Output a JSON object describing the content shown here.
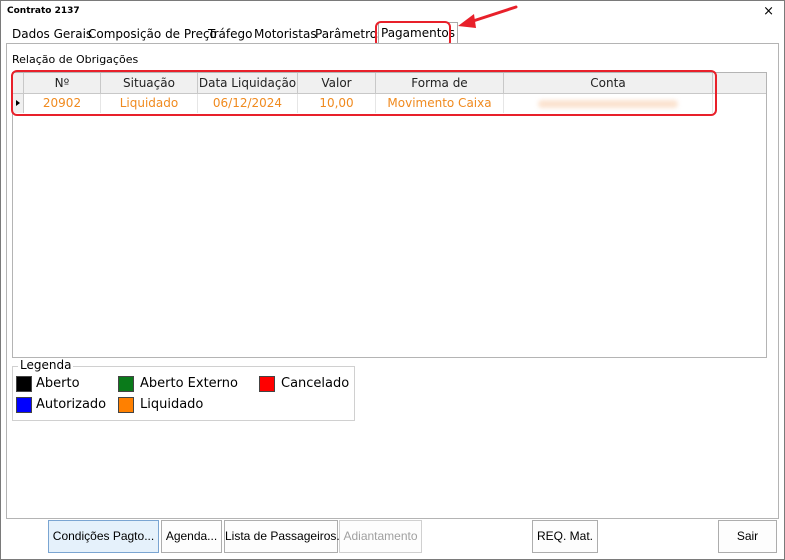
{
  "window": {
    "title": "Contrato 2137",
    "close_label": "×"
  },
  "tabs": [
    {
      "label": "Dados Gerais"
    },
    {
      "label": "Composição de Preço"
    },
    {
      "label": "Tráfego"
    },
    {
      "label": "Motoristas"
    },
    {
      "label": "Parâmetros"
    },
    {
      "label": "Pagamentos",
      "active": true
    }
  ],
  "section": {
    "label": "Relação de Obrigações"
  },
  "grid": {
    "columns": [
      "Nº Obrigação",
      "Situação",
      "Data Liquidação",
      "Valor",
      "Forma de Pagamento",
      "Conta"
    ],
    "rows": [
      {
        "numero": "20902",
        "situacao": "Liquidado",
        "data": "06/12/2024",
        "valor": "10,00",
        "forma": "Movimento Caixa",
        "conta": ""
      }
    ]
  },
  "legend": {
    "title": "Legenda",
    "items": [
      {
        "label": "Aberto",
        "color": "#000000"
      },
      {
        "label": "Aberto Externo",
        "color": "#0a7a1a"
      },
      {
        "label": "Cancelado",
        "color": "#ff0000"
      },
      {
        "label": "Autorizado",
        "color": "#0000ff"
      },
      {
        "label": "Liquidado",
        "color": "#ff8000"
      }
    ]
  },
  "buttons": {
    "condicoes": "Condições Pagto...",
    "agenda": "Agenda...",
    "lista": "Lista de Passageiros...",
    "adiantamento": "Adiantamento",
    "req": "REQ. Mat.",
    "sair": "Sair"
  },
  "colors": {
    "highlight": "#e8202a",
    "liquidado_text": "#f08a1e"
  }
}
